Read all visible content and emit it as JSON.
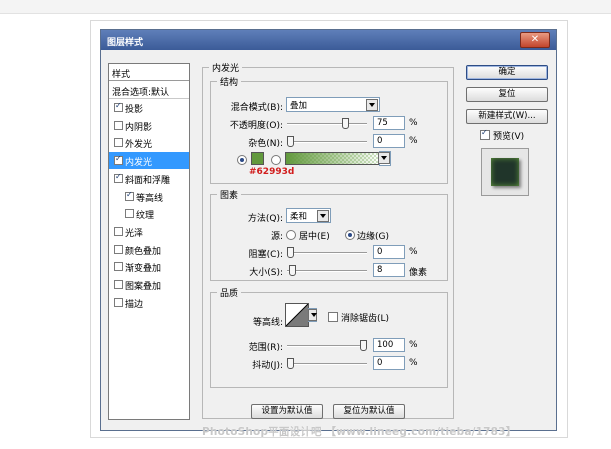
{
  "dialog": {
    "title": "图层样式",
    "close_glyph": "✕"
  },
  "sidebar": {
    "header": "样式",
    "blend_options": "混合选项:默认",
    "items": [
      {
        "label": "投影",
        "checked": true
      },
      {
        "label": "内阴影",
        "checked": false
      },
      {
        "label": "外发光",
        "checked": false
      },
      {
        "label": "内发光",
        "checked": true,
        "selected": true
      },
      {
        "label": "斜面和浮雕",
        "checked": true
      },
      {
        "label": "等高线",
        "checked": true,
        "sub": true
      },
      {
        "label": "纹理",
        "checked": false,
        "sub": true
      },
      {
        "label": "光泽",
        "checked": false
      },
      {
        "label": "颜色叠加",
        "checked": false
      },
      {
        "label": "渐变叠加",
        "checked": false
      },
      {
        "label": "图案叠加",
        "checked": false
      },
      {
        "label": "描边",
        "checked": false
      }
    ]
  },
  "inner_glow": {
    "title": "内发光",
    "structure": {
      "title": "结构",
      "blend_mode_label": "混合模式(B):",
      "blend_mode_value": "叠加",
      "opacity_label": "不透明度(O):",
      "opacity_value": "75",
      "opacity_unit": "%",
      "opacity_level": 75,
      "noise_label": "杂色(N):",
      "noise_value": "0",
      "noise_unit": "%",
      "noise_level": 0,
      "color_hex": "#62993d",
      "color_annotation": "#62993d"
    },
    "elements": {
      "title": "图素",
      "technique_label": "方法(Q):",
      "technique_value": "柔和",
      "source_label": "源:",
      "source_center": "居中(E)",
      "source_edge": "边缘(G)",
      "choke_label": "阻塞(C):",
      "choke_value": "0",
      "choke_unit": "%",
      "choke_level": 0,
      "size_label": "大小(S):",
      "size_value": "8",
      "size_unit": "像素",
      "size_level": 3
    },
    "quality": {
      "title": "品质",
      "contour_label": "等高线:",
      "anti_alias_label": "消除锯齿(L)",
      "range_label": "范围(R):",
      "range_value": "100",
      "range_unit": "%",
      "range_level": 100,
      "jitter_label": "抖动(J):",
      "jitter_value": "0",
      "jitter_unit": "%",
      "jitter_level": 0
    },
    "make_default": "设置为默认值",
    "reset_default": "复位为默认值"
  },
  "buttons": {
    "ok": "确定",
    "reset": "复位",
    "new_style": "新建样式(W)...",
    "preview_label": "预览(V)"
  },
  "watermark": "PhotoShop平面设计吧 【www.lineeg.com/tieba/1783】"
}
